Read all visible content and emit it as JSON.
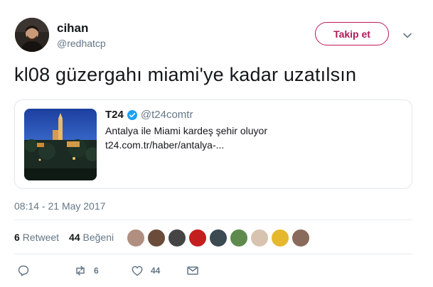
{
  "author": {
    "name": "cihan",
    "handle": "@redhatcp",
    "follow_label": "Takip et"
  },
  "tweet": {
    "text": "kl08 güzergahı miami'ye kadar uzatılsın",
    "timestamp": "08:14 - 21 May 2017"
  },
  "card": {
    "title": "T24",
    "handle": "@t24comtr",
    "description": "Antalya ile Miami kardeş şehir oluyor",
    "url": "t24.com.tr/haber/antalya-..."
  },
  "stats": {
    "retweet_count": "6",
    "retweet_label": "Retweet",
    "like_count": "44",
    "like_label": "Beğeni"
  },
  "actions": {
    "retweet_count": "6",
    "like_count": "44"
  },
  "colors": {
    "brand": "#b0195a",
    "muted": "#657786",
    "verified": "#1da1f2"
  }
}
